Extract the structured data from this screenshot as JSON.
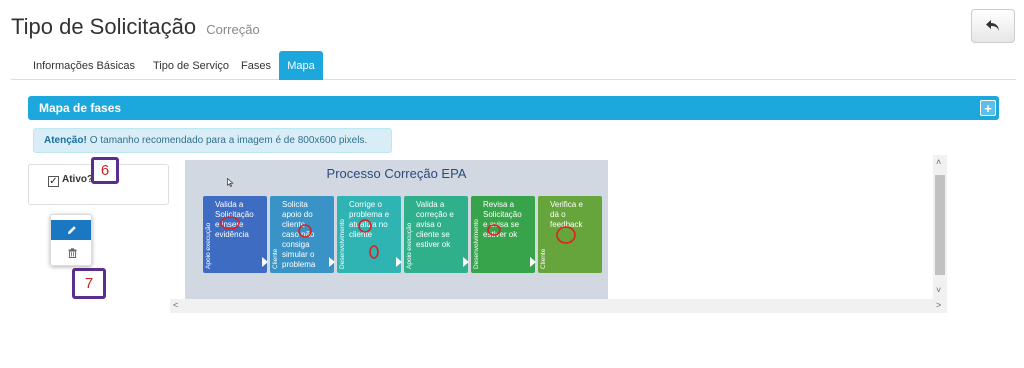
{
  "header": {
    "title": "Tipo de Solicitação",
    "subtitle": "Correção"
  },
  "tabs": [
    {
      "label": "Informações Básicas",
      "active": false
    },
    {
      "label": "Tipo de Serviço",
      "active": false
    },
    {
      "label": "Fases",
      "active": false
    },
    {
      "label": "Mapa",
      "active": true
    }
  ],
  "panel": {
    "title": "Mapa de fases",
    "add_icon": "plus-icon"
  },
  "alert": {
    "strong": "Atenção!",
    "text": "O tamanho recomendado para a imagem é de 800x600 pixels."
  },
  "active_option": {
    "label": "Ativo?",
    "checked": true
  },
  "callouts": [
    "6",
    "7"
  ],
  "actions": {
    "edit_icon": "pencil-icon",
    "delete_icon": "trash-icon"
  },
  "diagram": {
    "title": "Processo Correção EPA",
    "phases": [
      {
        "role": "Apoio execução",
        "text": "Valida a Solicitação e insere evidência",
        "color": "#3d6cc2"
      },
      {
        "role": "Cliente",
        "text": "Solicita apoio do cliente caso não consiga simular o problema",
        "color": "#3a93c6"
      },
      {
        "role": "Desenvolvimento",
        "text": "Corrige o problema e atualiza no cliente",
        "color": "#2fb3b3"
      },
      {
        "role": "Apoio execução",
        "text": "Valida a correção e avisa o cliente se estiver ok",
        "color": "#2fb08a"
      },
      {
        "role": "Desenvolvimento",
        "text": "Revisa a Solicitação e avisa se estiver ok",
        "color": "#37a34a"
      },
      {
        "role": "Cliente",
        "text": "Verifica e dá o feedback",
        "color": "#66a53b"
      }
    ]
  },
  "colors": {
    "accent": "#1ca8dd",
    "callout_border": "#5b2d8e",
    "callout_text": "#cc2222",
    "annotation_circle": "#e02020"
  }
}
